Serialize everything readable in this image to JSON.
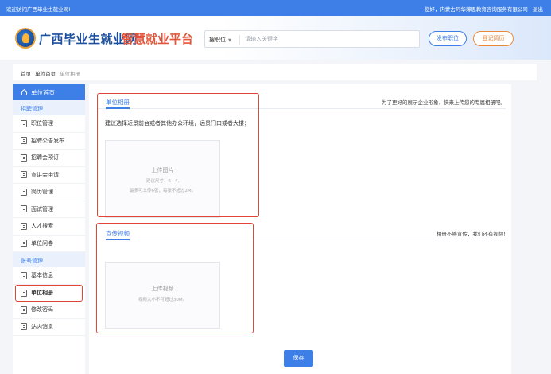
{
  "topbar": {
    "welcome": "欢迎访问广西毕业生就业网!",
    "greeting": "您好，内蒙古阿华薄思教育咨询服务有限公司",
    "logout": "退出"
  },
  "header": {
    "logo_main": "广西毕业生就业网",
    "logo_sub": "智慧就业平台",
    "search_scope": "搜职位",
    "search_placeholder": "请输入关键字",
    "post_job": "发布职位",
    "register_resume": "登记简历"
  },
  "breadcrumb": [
    "首页",
    "单位首页",
    "单位相册"
  ],
  "sidebar": {
    "home": "单位首页",
    "sections": [
      {
        "title": "招聘管理",
        "items": [
          "职位管理",
          "招聘公告发布",
          "招聘会预订",
          "宣讲会申请",
          "简历管理",
          "面试管理",
          "人才搜索",
          "单位问卷"
        ]
      },
      {
        "title": "账号管理",
        "items": [
          "基本信息",
          "单位相册",
          "修改密码",
          "站内消息"
        ]
      }
    ]
  },
  "album": {
    "tab": "单位相册",
    "hint": "为了更好的展示企业形象，快来上传您的专属相册吧。",
    "instruction": "建议选择近景前台或者其他办公环境，远景门口或者大楼；",
    "upload_title": "上传图片",
    "upload_size": "建议尺寸：6 ∶ 4,",
    "upload_limit": "最多可上传6张，每张不超过2M。"
  },
  "video": {
    "tab": "宣传视频",
    "hint": "相册不够宣传，我们还有视频!",
    "upload_title": "上传视频",
    "upload_limit": "视频大小不可超过30M。"
  },
  "save_label": "保存",
  "colors": {
    "primary": "#3d7fe6",
    "highlight": "#e04535",
    "accent": "#e8893c"
  }
}
